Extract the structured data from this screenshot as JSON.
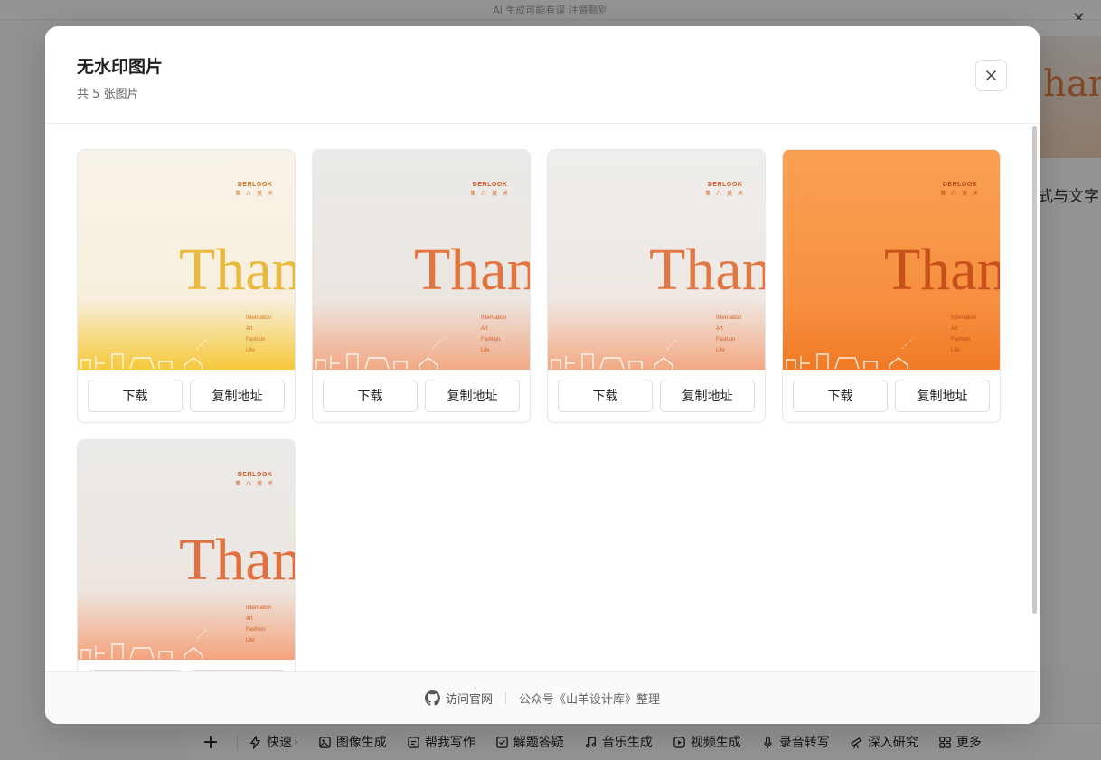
{
  "background": {
    "disclaimer": "AI 生成可能有误 注意甄别",
    "right_panel_text": "式与文字",
    "right_thumb_text": "han",
    "toolbar": {
      "plus": "+",
      "items": [
        {
          "label": "快速",
          "icon": "lightning-icon"
        },
        {
          "label": "图像生成",
          "icon": "image-icon"
        },
        {
          "label": "帮我写作",
          "icon": "edit-icon"
        },
        {
          "label": "解题答疑",
          "icon": "check-book-icon"
        },
        {
          "label": "音乐生成",
          "icon": "music-icon"
        },
        {
          "label": "视频生成",
          "icon": "video-icon"
        },
        {
          "label": "录音转写",
          "icon": "mic-icon"
        },
        {
          "label": "深入研究",
          "icon": "telescope-icon"
        },
        {
          "label": "更多",
          "icon": "grid-icon"
        }
      ]
    }
  },
  "modal": {
    "title": "无水印图片",
    "subtitle": "共 5 张图片",
    "close_icon": "close-icon",
    "download_label": "下载",
    "copy_label": "复制地址",
    "images": [
      {
        "brand": "DERLOOK",
        "brand_sub": "第 八 美 术",
        "headline": "Than",
        "lines": [
          "Internation",
          "Art",
          "Fashion",
          "Life"
        ],
        "bg_top": "#f8f3ea",
        "bg_mid": "#f7efdc",
        "bg_bottom": "#f6c83a",
        "text_color": "#e9b93d",
        "accent": "#d2731f"
      },
      {
        "brand": "DERLOOK",
        "brand_sub": "第 八 美 术",
        "headline": "Than",
        "lines": [
          "Internation",
          "Art",
          "Fashion",
          "Life"
        ],
        "bg_top": "#ebeae8",
        "bg_mid": "#ece6e1",
        "bg_bottom": "#f2a884",
        "text_color": "#e2743d",
        "accent": "#d35a22"
      },
      {
        "brand": "DERLOOK",
        "brand_sub": "第 八 美 术",
        "headline": "Than",
        "lines": [
          "Internation",
          "Art",
          "Fashion",
          "Life"
        ],
        "bg_top": "#efeeec",
        "bg_mid": "#efe8e3",
        "bg_bottom": "#f3a984",
        "text_color": "#e07844",
        "accent": "#d35a22"
      },
      {
        "brand": "DERLOOK",
        "brand_sub": "第 八 美 术",
        "headline": "Than",
        "lines": [
          "Internation",
          "Art",
          "Fashion",
          "Life"
        ],
        "bg_top": "#f8a052",
        "bg_mid": "#f79040",
        "bg_bottom": "#f07a25",
        "text_color": "#c8501a",
        "accent": "#b8431b"
      },
      {
        "brand": "DERLOOK",
        "brand_sub": "第 八 美 术",
        "headline": "Than",
        "lines": [
          "Internation",
          "Art",
          "Fashion",
          "Life"
        ],
        "bg_top": "#ebeae8",
        "bg_mid": "#ede6e0",
        "bg_bottom": "#f4a37c",
        "text_color": "#e07040",
        "accent": "#d35a22"
      }
    ],
    "footer": {
      "link_label": "访问官网",
      "link_icon": "github-icon",
      "note": "公众号《山羊设计库》整理"
    }
  }
}
